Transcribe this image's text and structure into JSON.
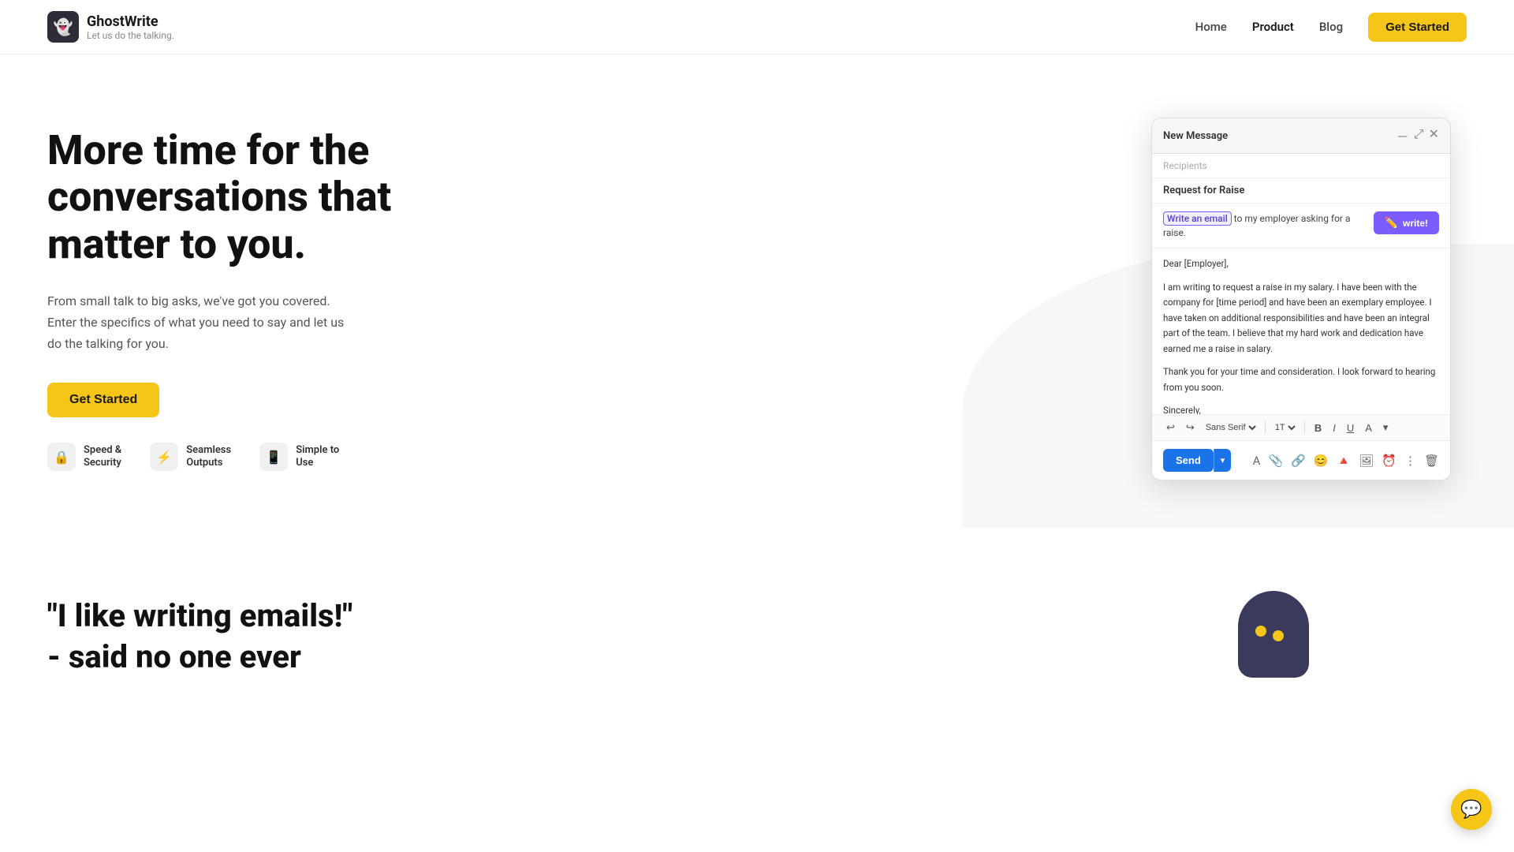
{
  "nav": {
    "brand": {
      "name": "GhostWrite",
      "tagline": "Let us do the talking."
    },
    "links": [
      {
        "label": "Home",
        "active": false
      },
      {
        "label": "Product",
        "active": true
      },
      {
        "label": "Blog",
        "active": false
      }
    ],
    "cta_label": "Get Started"
  },
  "hero": {
    "title": "More time for the conversations that matter to you.",
    "subtitle": "From small talk to big asks, we've got you covered. Enter the specifics of what you need to say and let us do the talking for you.",
    "cta_label": "Get Started",
    "features": [
      {
        "icon": "🔒",
        "label": "Speed &\nSecurity"
      },
      {
        "icon": "⚡",
        "label": "Seamless\nOutputs"
      },
      {
        "icon": "📱",
        "label": "Simple to\nUse"
      }
    ]
  },
  "email_card": {
    "header_title": "New Message",
    "recipients_placeholder": "Recipients",
    "subject": "Request for Raise",
    "prompt_highlight": "Write an email",
    "prompt_text": " to my employer asking for a raise.",
    "write_button": "write!",
    "body_lines": [
      "Dear [Employer],",
      "I am writing to request a raise in my salary. I have been with the company for [time period] and have been an exemplary employee. I have taken on additional responsibilities and have been an integral part of the team. I believe that my hard work and dedication have earned me a raise in salary.",
      "Thank you for your time and consideration. I look forward to hearing from you soon.",
      "Sincerely,"
    ],
    "toolbar": {
      "font": "Sans Serif",
      "size": "1T"
    },
    "send_button": "Send",
    "footer_icons": [
      "A",
      "📎",
      "🔗",
      "😊",
      "🔺",
      "🖼",
      "⏰"
    ]
  },
  "quote": {
    "line1": "\"I like writing emails!\"",
    "line2": "- said no one ever"
  }
}
